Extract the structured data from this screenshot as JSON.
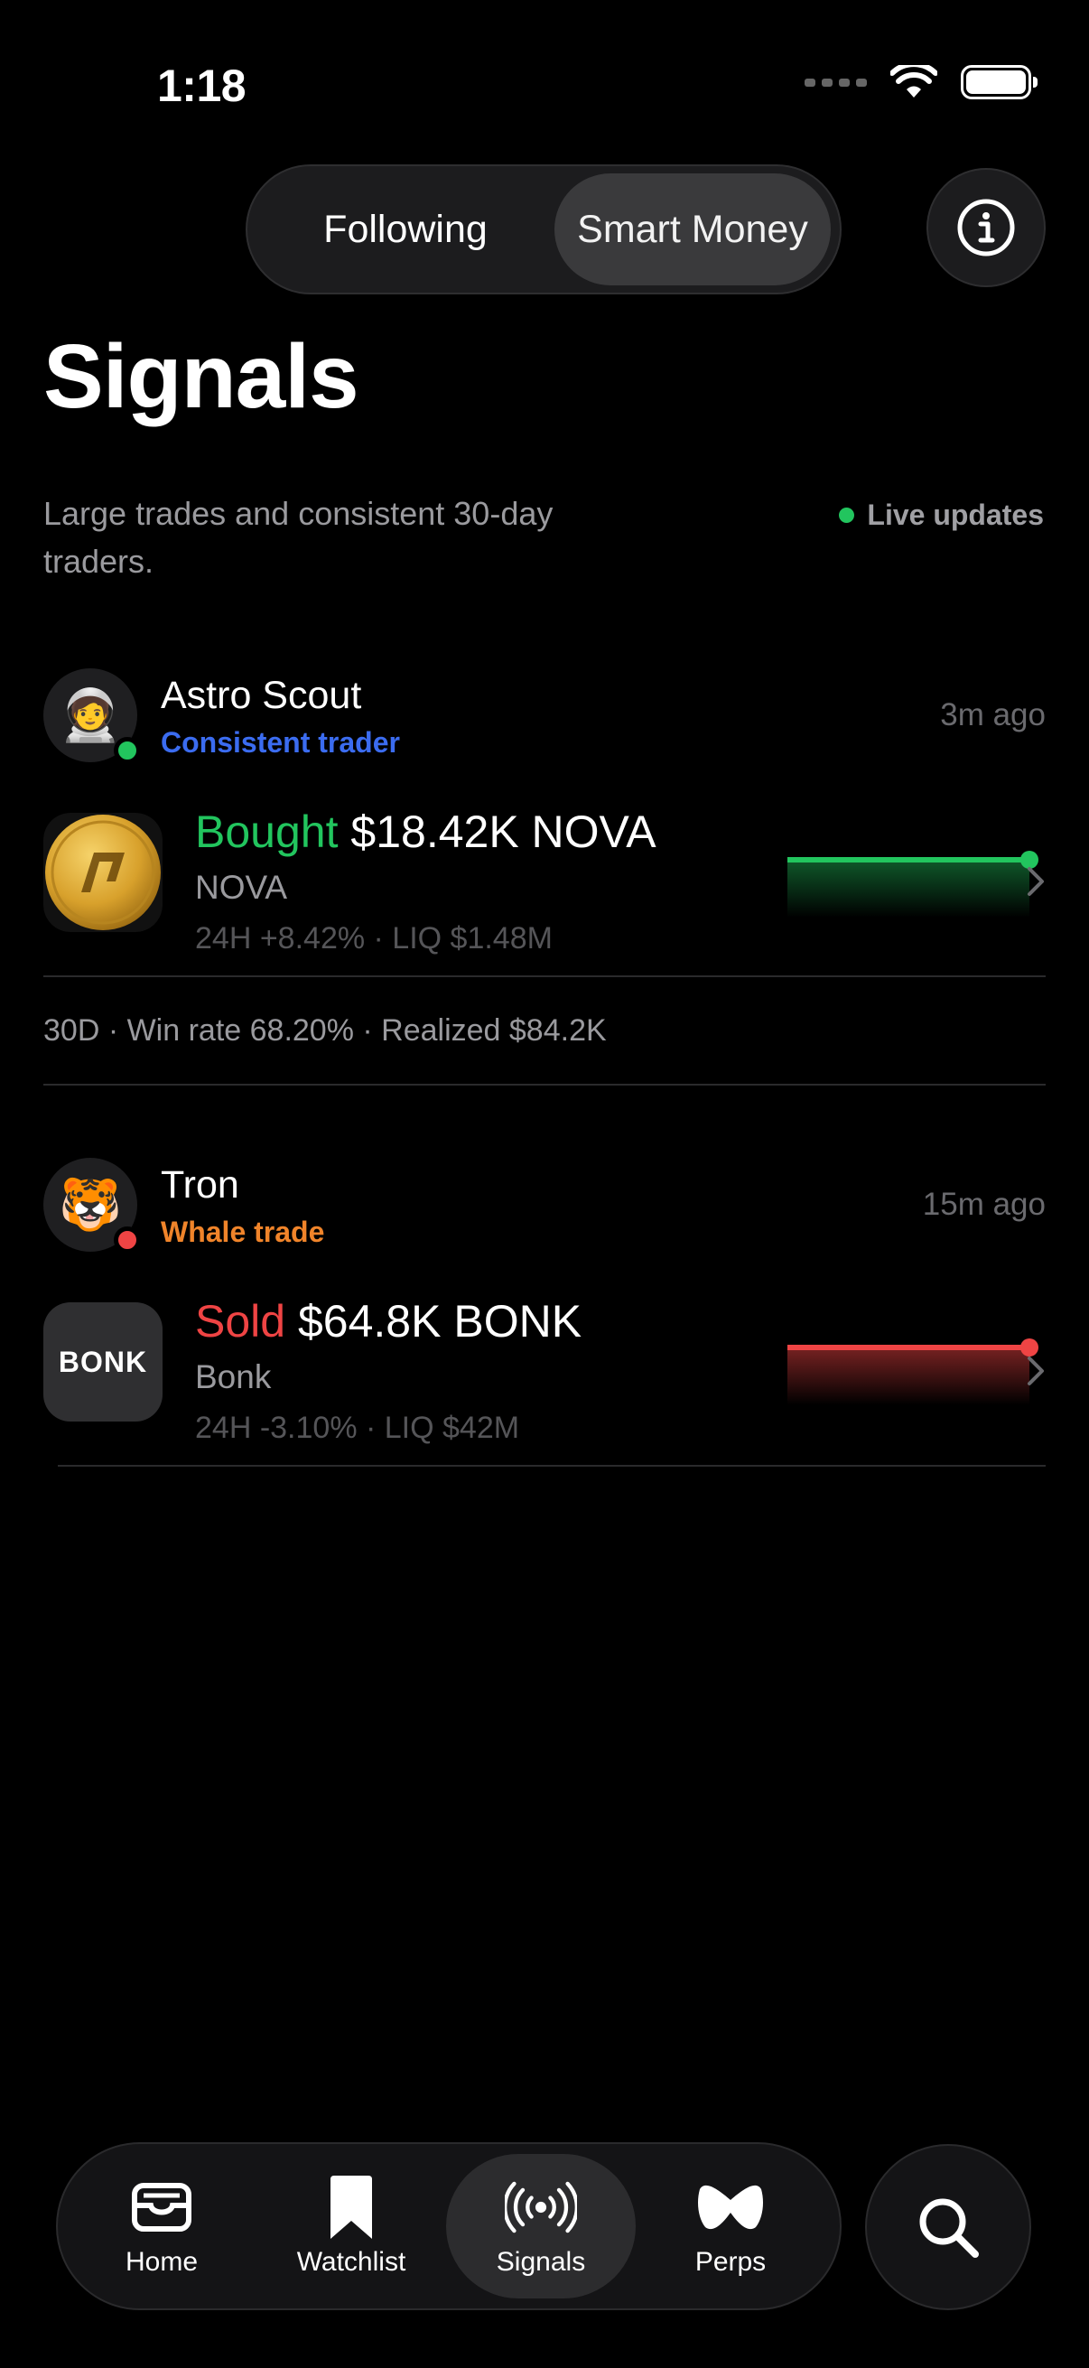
{
  "status_bar": {
    "time": "1:18"
  },
  "segmented": {
    "following_label": "Following",
    "smart_money_label": "Smart Money",
    "selected": "Smart Money"
  },
  "header": {
    "title": "Signals",
    "subtitle": "Large trades and consistent 30-day traders.",
    "live_label": "Live updates"
  },
  "signals": [
    {
      "trader": "Astro Scout",
      "avatar_emoji": "🧑‍🚀",
      "tag": "Consistent trader",
      "tag_color": "#3b6cf0",
      "status_color": "#22c55e",
      "time_ago": "3m ago",
      "action": "Bought",
      "action_color": "#22c55e",
      "amount": "$18.42K NOVA",
      "token_name": "NOVA",
      "token_stats": "24H +8.42% · LIQ $1.48M",
      "performance": "30D · Win rate 68.20% · Realized $84.2K"
    },
    {
      "trader": "Tron",
      "avatar_emoji": "🐯",
      "tag": "Whale trade",
      "tag_color": "#f0842a",
      "status_color": "#ef4444",
      "time_ago": "15m ago",
      "action": "Sold",
      "action_color": "#ef4444",
      "amount": "$64.8K BONK",
      "token_name": "Bonk",
      "token_logo_text": "BONK",
      "token_stats": "24H -3.10% · LIQ $42M"
    }
  ],
  "tabbar": {
    "tabs": [
      {
        "label": "Home",
        "icon": "inbox-icon"
      },
      {
        "label": "Watchlist",
        "icon": "bookmark-icon"
      },
      {
        "label": "Signals",
        "icon": "broadcast-icon",
        "active": true
      },
      {
        "label": "Perps",
        "icon": "perps-icon"
      }
    ],
    "search_icon": "search-icon"
  }
}
